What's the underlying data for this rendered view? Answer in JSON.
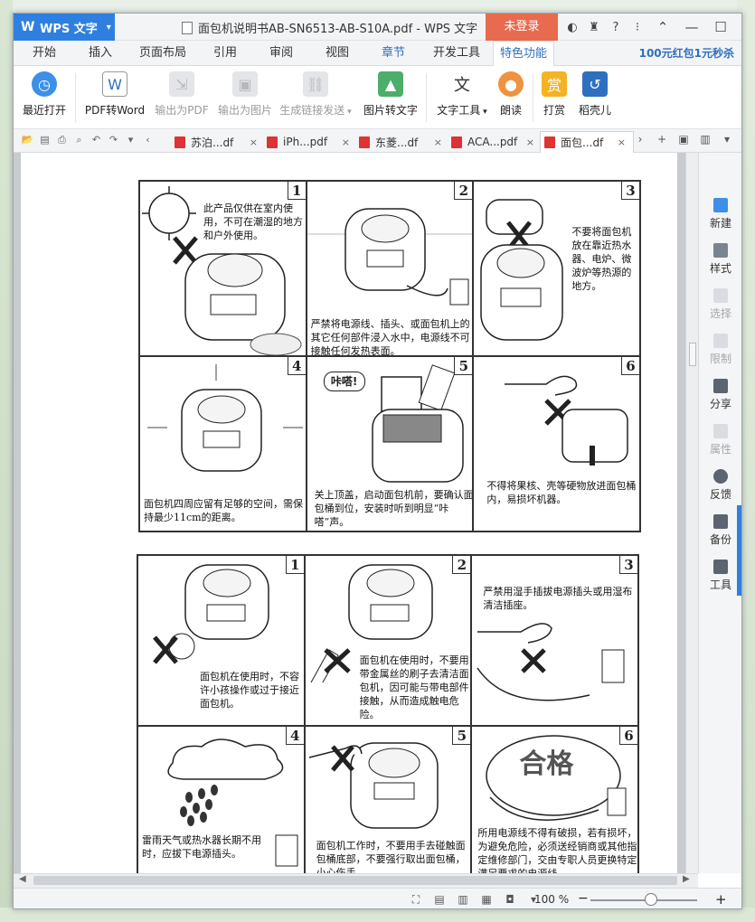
{
  "app": {
    "name": "WPS 文字",
    "doc_title": "面包机说明书AB-SN6513-AB-S10A.pdf - WPS 文字",
    "login": "未登录"
  },
  "menu": {
    "tabs": [
      "开始",
      "插入",
      "页面布局",
      "引用",
      "审阅",
      "视图",
      "章节",
      "开发工具",
      "特色功能"
    ],
    "active": "特色功能",
    "promo": "100元红包1元秒杀"
  },
  "ribbon": {
    "recent": "最近打开",
    "pdf_to_word": "PDF转Word",
    "export_pdf": "输出为PDF",
    "export_image": "输出为图片",
    "share_link": "生成链接发送",
    "image_to_text": "图片转文字",
    "text_tools": "文字工具",
    "read_aloud": "朗读",
    "reward": "打赏",
    "daoke": "稻壳儿"
  },
  "doc_tabs": [
    "苏泊...df",
    "iPh...pdf",
    "东菱...df",
    "ACA...pdf",
    "面包...df"
  ],
  "panel1": {
    "cells": [
      {
        "n": "1",
        "text": "此产品仅供在室内使用，不可在潮湿的地方和户外使用。"
      },
      {
        "n": "2",
        "text": "严禁将电源线、插头、或面包机上的其它任何部件浸入水中，电源线不可接触任何发热表面。"
      },
      {
        "n": "3",
        "text": "不要将面包机放在靠近热水器、电炉、微波炉等热源的地方。"
      },
      {
        "n": "4",
        "text": "面包机四周应留有足够的空间，需保持最少11cm的距离。"
      },
      {
        "n": "5",
        "text": "关上顶盖，启动面包机前，要确认面包桶到位，安装时听到明显“咔嗒”声。",
        "bubble": "咔嗒!"
      },
      {
        "n": "6",
        "text": "不得将果核、壳等硬物放进面包桶内，易损坏机器。"
      }
    ]
  },
  "panel2": {
    "cells": [
      {
        "n": "1",
        "text": "面包机在使用时，不容许小孩操作或过于接近面包机。"
      },
      {
        "n": "2",
        "text": "面包机在使用时，不要用带金属丝的刷子去清洁面包机，因可能与带电部件接触，从而造成触电危险。"
      },
      {
        "n": "3",
        "text": "严禁用湿手插拔电源插头或用湿布清洁插座。"
      },
      {
        "n": "4",
        "text": "雷雨天气或热水器长期不用时，应拔下电源插头。"
      },
      {
        "n": "5",
        "text": "面包机工作时，不要用手去碰触面包桶底部，不要强行取出面包桶，小心伤手。"
      },
      {
        "n": "6",
        "text": "所用电源线不得有破损，若有损坏，为避免危险，必须送经销商或其他指定维修部门，交由专职人员更换特定满足要求的电源线。",
        "stamp": "合格"
      }
    ]
  },
  "right_panel": [
    "新建",
    "样式",
    "选择",
    "限制",
    "分享",
    "属性",
    "反馈",
    "备份",
    "工具"
  ],
  "status": {
    "zoom": "100 %"
  }
}
